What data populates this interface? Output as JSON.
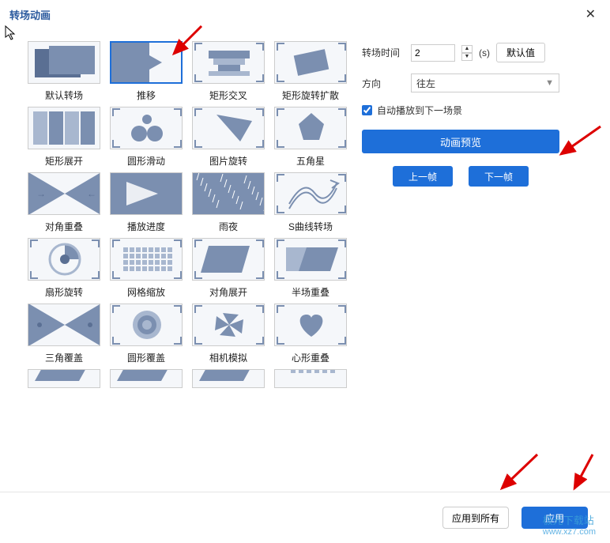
{
  "dialog": {
    "title": "转场动画",
    "close": "✕"
  },
  "transitions": [
    {
      "id": "default",
      "label": "默认转场"
    },
    {
      "id": "push",
      "label": "推移"
    },
    {
      "id": "rect-cross",
      "label": "矩形交叉"
    },
    {
      "id": "rect-spin-spread",
      "label": "矩形旋转扩散"
    },
    {
      "id": "rect-expand",
      "label": "矩形展开"
    },
    {
      "id": "circle-slide",
      "label": "圆形滑动"
    },
    {
      "id": "image-rotate",
      "label": "图片旋转"
    },
    {
      "id": "pentagon",
      "label": "五角星"
    },
    {
      "id": "diagonal-overlap",
      "label": "对角重叠"
    },
    {
      "id": "play-progress",
      "label": "播放进度"
    },
    {
      "id": "rainy-night",
      "label": "雨夜"
    },
    {
      "id": "s-curve",
      "label": "S曲线转场"
    },
    {
      "id": "fan-rotate",
      "label": "扇形旋转"
    },
    {
      "id": "grid-zoom",
      "label": "网格缩放"
    },
    {
      "id": "diagonal-expand",
      "label": "对角展开"
    },
    {
      "id": "half-overlap",
      "label": "半场重叠"
    },
    {
      "id": "triangle-cover",
      "label": "三角覆盖"
    },
    {
      "id": "circle-cover",
      "label": "圆形覆盖"
    },
    {
      "id": "camera-sim",
      "label": "相机模拟"
    },
    {
      "id": "heart-overlap",
      "label": "心形重叠"
    }
  ],
  "selected": 1,
  "settings": {
    "duration_label": "转场时间",
    "duration_value": "2",
    "duration_unit": "(s)",
    "default_btn": "默认值",
    "direction_label": "方向",
    "direction_value": "往左",
    "autoplay_label": "自动播放到下一场景",
    "autoplay_checked": true
  },
  "buttons": {
    "preview": "动画预览",
    "prev_frame": "上一帧",
    "next_frame": "下一帧",
    "apply_all": "应用到所有",
    "apply": "应用"
  },
  "watermark": {
    "top": "极光下载站",
    "bottom": "www.xz7.com"
  }
}
